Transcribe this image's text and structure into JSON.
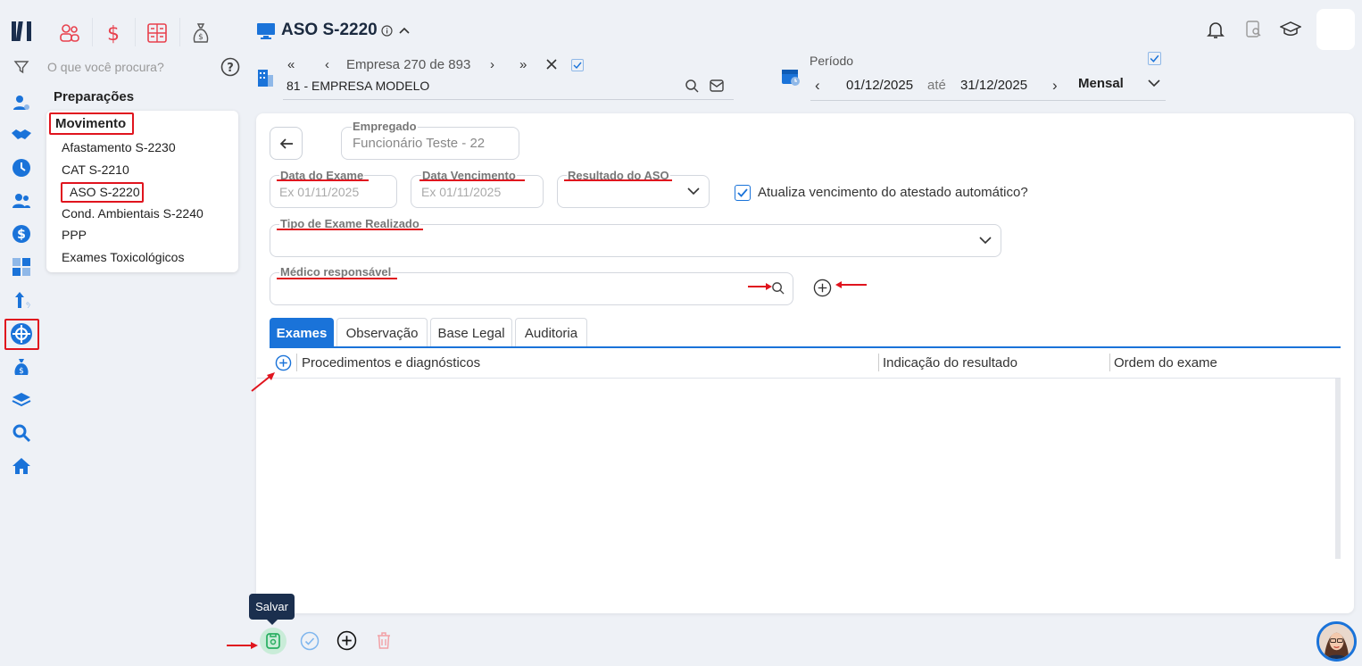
{
  "header": {
    "title": "ASO S-2220",
    "search_placeholder": "O que você procura?"
  },
  "company_nav": {
    "label": "Empresa",
    "current": "270",
    "of_label": "de",
    "total": "893",
    "company_name": "81 - EMPRESA MODELO"
  },
  "period": {
    "label": "Período",
    "start": "01/12/2025",
    "between": "até",
    "end": "31/12/2025",
    "mode": "Mensal"
  },
  "menu": {
    "section_prep": "Preparações",
    "section_mov": "Movimento",
    "items": [
      "Afastamento S-2230",
      "CAT S-2210",
      "ASO S-2220",
      "Cond. Ambientais S-2240",
      "PPP",
      "Exames Toxicológicos"
    ]
  },
  "form": {
    "employee_label": "Empregado",
    "employee_value": "Funcionário Teste - 22",
    "exam_date_label": "Data do Exame",
    "exam_date_placeholder": "Ex 01/11/2025",
    "due_date_label": "Data Vencimento",
    "due_date_placeholder": "Ex 01/11/2025",
    "result_label": "Resultado do ASO",
    "auto_update_label": "Atualiza vencimento do atestado automático?",
    "auto_update_checked": true,
    "exam_type_label": "Tipo de Exame Realizado",
    "doctor_label": "Médico responsável"
  },
  "tabs": [
    "Exames",
    "Observação",
    "Base Legal",
    "Auditoria"
  ],
  "table": {
    "columns": [
      "Procedimentos e diagnósticos",
      "Indicação do resultado",
      "Ordem do exame"
    ],
    "rows": []
  },
  "footer": {
    "save_tooltip": "Salvar"
  },
  "colors": {
    "accent": "#1a73d9",
    "highlight": "#e0141e",
    "dark_nav": "#1b2f4e",
    "save_green": "#27ae60"
  }
}
